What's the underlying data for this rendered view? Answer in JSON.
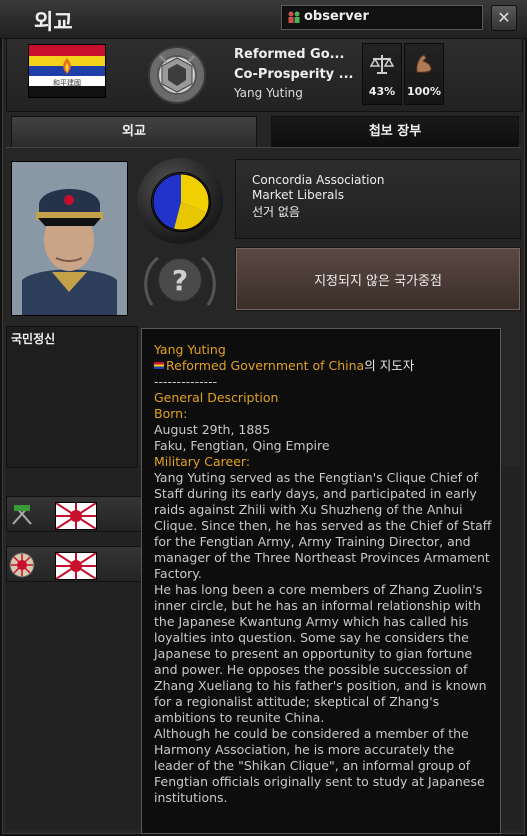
{
  "window": {
    "title": "외교",
    "observer": "observer",
    "close_symbol": "✕"
  },
  "country": {
    "government": "Reformed Go...",
    "ideology": "Co-Prosperity ...",
    "leader": "Yang Yuting",
    "stability": "43%",
    "war_support": "100%",
    "flag_caption": "和平建國"
  },
  "tabs": [
    {
      "label": "외교",
      "active": true
    },
    {
      "label": "첩보 장부",
      "active": false
    }
  ],
  "party": {
    "name": "Concordia Association",
    "ideology": "Market Liberals",
    "election": "선거 없음"
  },
  "national_focus": {
    "label": "지정되지 않은 국가중점"
  },
  "spirits": {
    "label": "국민정신"
  },
  "tooltip": {
    "leader_name": "Yang Yuting",
    "country_link": "Reformed Government of China",
    "country_suffix": "의 지도자",
    "separator": "--------------",
    "section_general": "General Description",
    "born_label": "Born:",
    "born_date": "August 29th, 1885",
    "born_place": "Faku, Fengtian, Qing Empire",
    "career_label": "Military Career:",
    "body": "Yang Yuting served as the Fengtian's Clique Chief of Staff during its early days, and participated in early raids against Zhili with Xu Shuzheng of the Anhui Clique. Since then, he has served as the Chief of Staff for the Fengtian Army, Army Training Director, and manager of the Three Northeast Provinces Armament Factory.\nHe has long been a core members of Zhang Zuolin's inner circle, but he has an informal relationship with the Japanese Kwantung Army which has called his loyalties into question. Some say he considers the Japanese to present an opportunity to gian fortune and power. He opposes the possible succession of Zhang Xueliang to his father's position, and is known for a regionalist attitude; skeptical of Zhang's ambitions to reunite China.\nAlthough he could be considered a member of the Harmony Association, he is more accurately the leader of the \"Shikan Clique\", an informal group of Fengtian officials originally sent to study at Japanese institutions."
  },
  "colors": {
    "gold_text": "#e0a21c",
    "flag_red": "#c8102e",
    "flag_yellow": "#f2d21a",
    "flag_blue": "#1e3fa8",
    "ideology_blue": "#2233cc",
    "ideology_yellow": "#f0d000"
  }
}
